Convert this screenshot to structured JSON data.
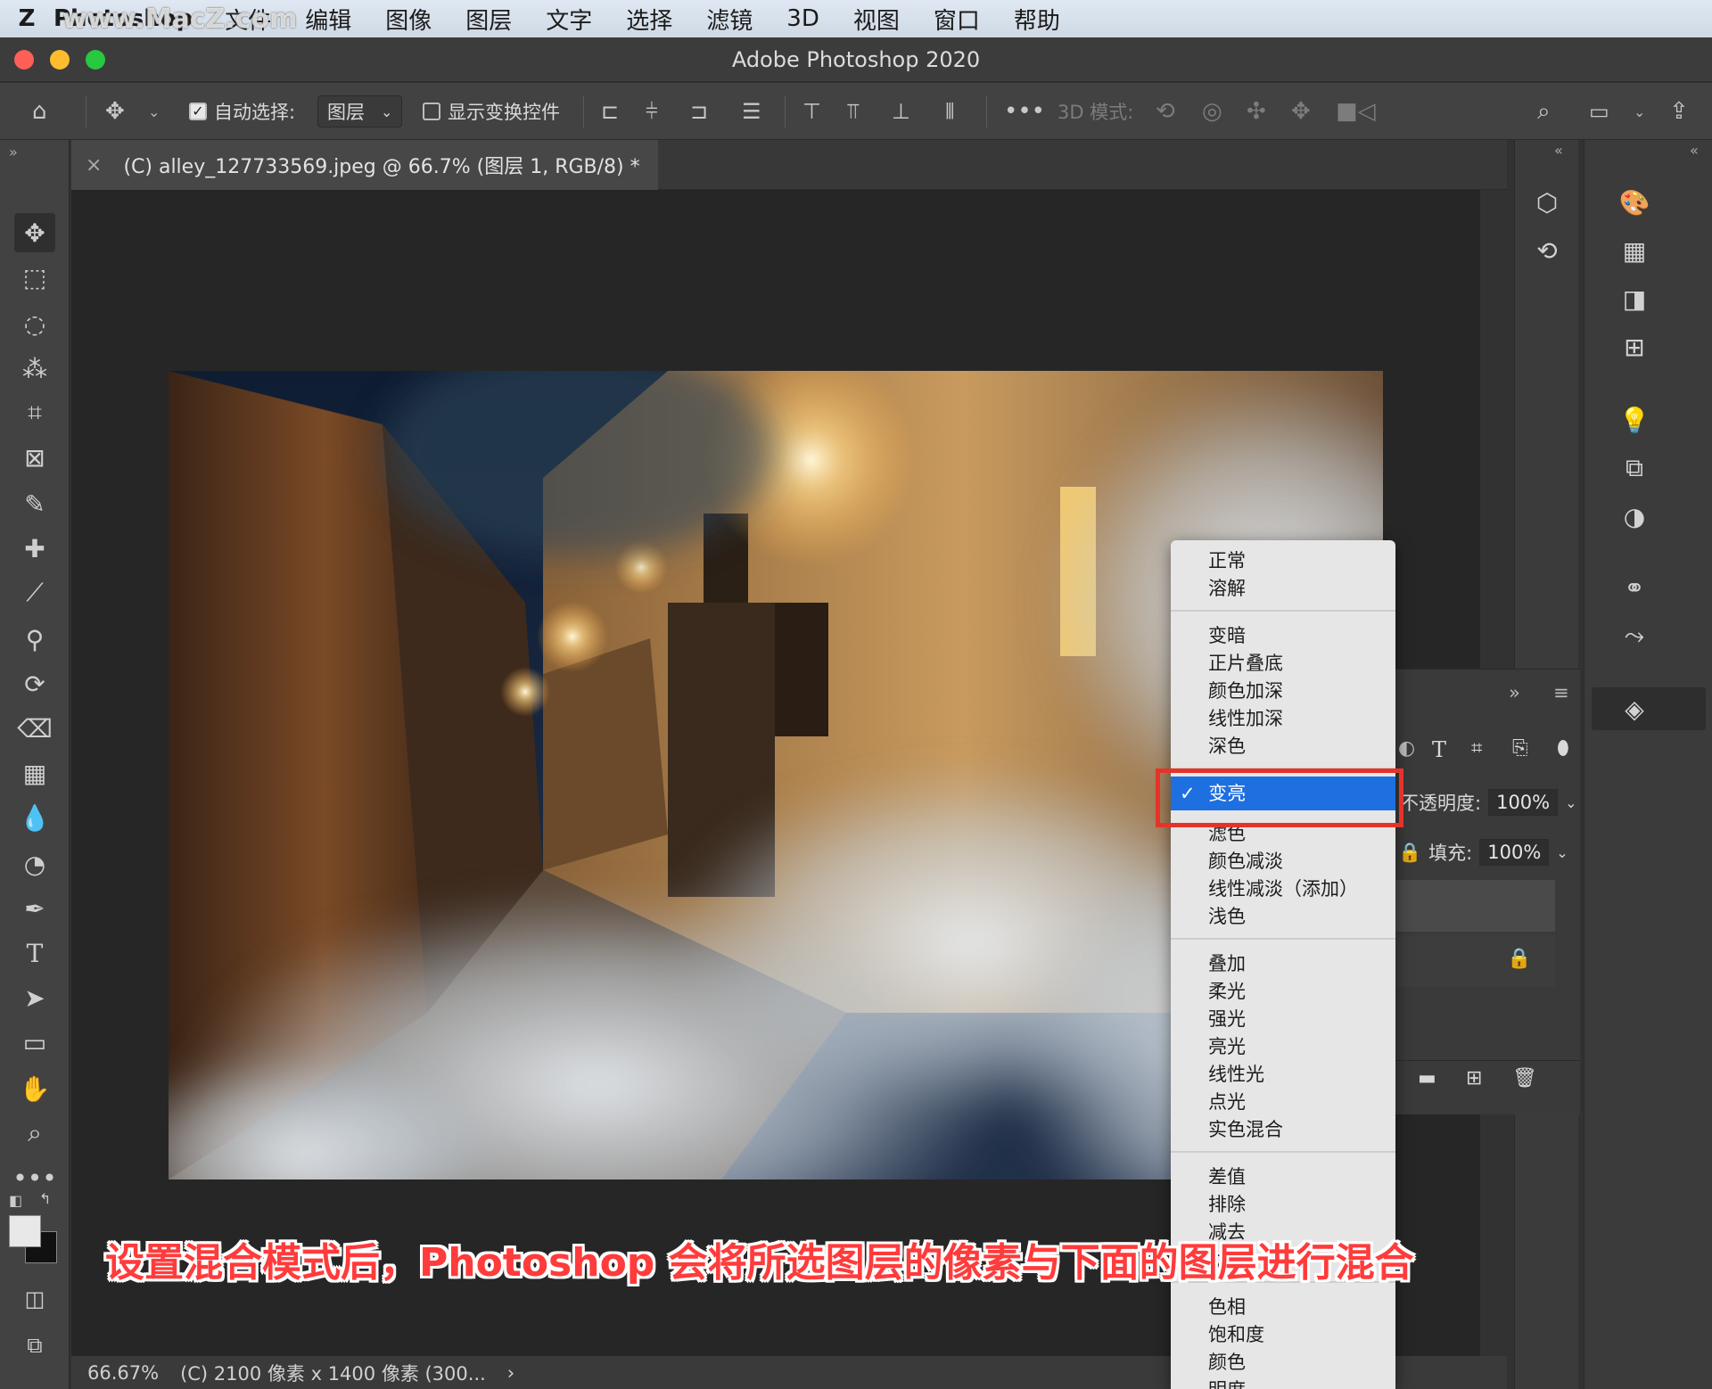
{
  "menubar": {
    "logo": "Z",
    "app_name": "Photoshop",
    "items": [
      "文件",
      "编辑",
      "图像",
      "图层",
      "文字",
      "选择",
      "滤镜",
      "3D",
      "视图",
      "窗口",
      "帮助"
    ],
    "watermark": "www.MacZ.com"
  },
  "window": {
    "title": "Adobe Photoshop 2020"
  },
  "options_bar": {
    "auto_select_label": "自动选择:",
    "auto_select_checked": true,
    "auto_select_target": "图层",
    "show_transform_label": "显示变换控件",
    "mode_3d_label": "3D 模式:"
  },
  "document": {
    "tab_title": "(C) alley_127733569.jpeg @ 66.7% (图层 1, RGB/8) *",
    "close_symbol": "×"
  },
  "status": {
    "zoom": "66.67%",
    "info": "(C) 2100 像素 x 1400 像素 (300...",
    "arrow": "›"
  },
  "layers_panel": {
    "opacity_label": "不透明度:",
    "opacity_value": "100%",
    "fill_label": "填充:",
    "fill_value": "100%"
  },
  "blend_menu": {
    "groups": [
      [
        "正常",
        "溶解"
      ],
      [
        "变暗",
        "正片叠底",
        "颜色加深",
        "线性加深",
        "深色"
      ],
      [
        "变亮",
        "滤色",
        "颜色减淡",
        "线性减淡（添加）",
        "浅色"
      ],
      [
        "叠加",
        "柔光",
        "强光",
        "亮光",
        "线性光",
        "点光",
        "实色混合"
      ],
      [
        "差值",
        "排除",
        "减去",
        "划分"
      ],
      [
        "色相",
        "饱和度",
        "颜色",
        "明度"
      ]
    ],
    "selected": "变亮",
    "check_symbol": "✓"
  },
  "subtitle": "设置混合模式后，Photoshop 会将所选图层的像素与下面的图层进行混合",
  "colors": {
    "accent_blue": "#1e6fe0",
    "highlight_red": "#e5332a",
    "subtitle_red": "#ff3b3b"
  }
}
